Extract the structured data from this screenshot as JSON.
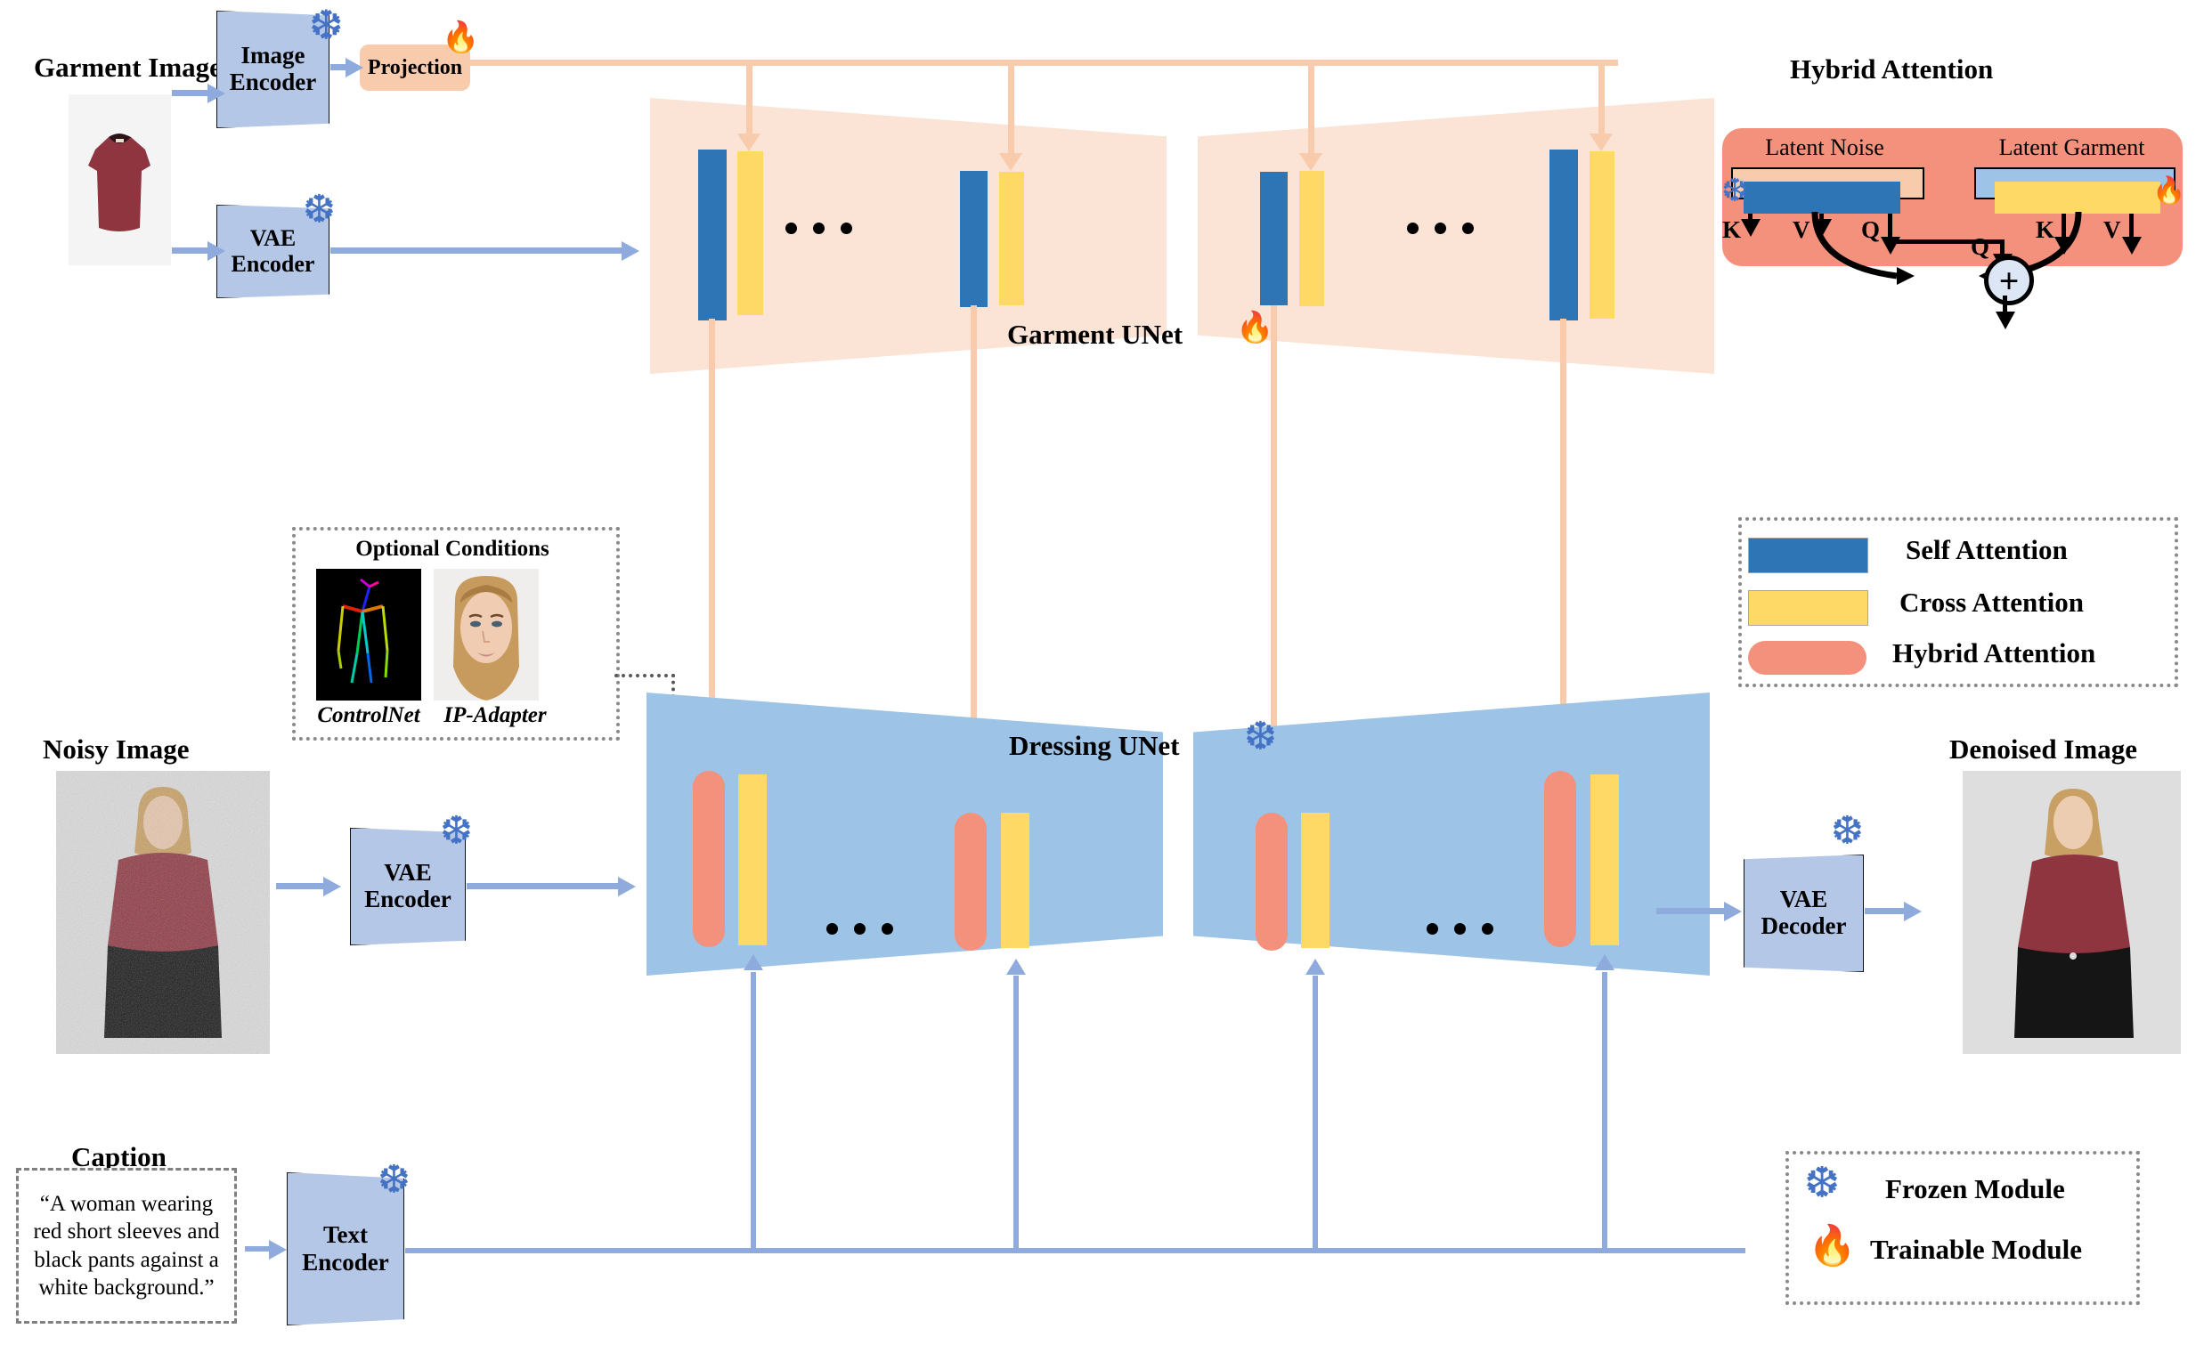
{
  "title": "Garment diffusion try-on architecture diagram",
  "inputs": {
    "garment_image_label": "Garment Image",
    "noisy_image_label": "Noisy Image",
    "caption_label": "Caption",
    "caption_text": "“A woman wearing red short sleeves and black pants against a white background.”"
  },
  "outputs": {
    "denoised_image_label": "Denoised Image"
  },
  "encoders": {
    "image_encoder": "Image\nEncoder",
    "image_encoder_l1": "Image",
    "image_encoder_l2": "Encoder",
    "vae_encoder_top_l1": "VAE",
    "vae_encoder_top_l2": "Encoder",
    "vae_encoder_bottom_l1": "VAE",
    "vae_encoder_bottom_l2": "Encoder",
    "text_encoder_l1": "Text",
    "text_encoder_l2": "Encoder",
    "vae_decoder_l1": "VAE",
    "vae_decoder_l2": "Decoder",
    "projection": "Projection"
  },
  "unets": {
    "garment_unet": "Garment UNet",
    "dressing_unet": "Dressing UNet"
  },
  "optional_conditions": {
    "title": "Optional Conditions",
    "items": [
      {
        "caption": "ControlNet"
      },
      {
        "caption": "IP-Adapter"
      }
    ]
  },
  "hybrid_attention": {
    "title": "Hybrid Attention",
    "left_label": "Latent Noise",
    "right_label": "Latent Garment",
    "left_qkv": [
      "K",
      "V",
      "Q"
    ],
    "right_qkv": [
      "Q",
      "K",
      "V"
    ],
    "sum_symbol": "+"
  },
  "attention_legend": {
    "items": [
      {
        "label": "Self Attention",
        "color": "#2e75b6",
        "shape": "rect"
      },
      {
        "label": "Cross Attention",
        "color": "#ffd966",
        "shape": "rect"
      },
      {
        "label": "Hybrid Attention",
        "color": "#f4917c",
        "shape": "pill"
      }
    ]
  },
  "module_legend": {
    "items": [
      {
        "label": "Frozen Module",
        "icon": "snowflake-icon",
        "glyph": "❆"
      },
      {
        "label": "Trainable Module",
        "icon": "flame-icon",
        "glyph": "🔥"
      }
    ]
  },
  "icons": {
    "snowflake": "❆",
    "flame": "🔥",
    "ellipsis": "• • •"
  },
  "colors": {
    "encoder_blue": "#b4c7e7",
    "garment_unet_peach": "#fbe3d5",
    "dressing_unet_blue": "#9dc3e6",
    "self_attention": "#2e75b6",
    "cross_attention": "#ffd966",
    "hybrid_attention": "#f4917c",
    "projection": "#f8cbad",
    "arrow_blue": "#8faadc",
    "arrow_peach": "#f8cbad",
    "snowflake": "#4472c4"
  }
}
